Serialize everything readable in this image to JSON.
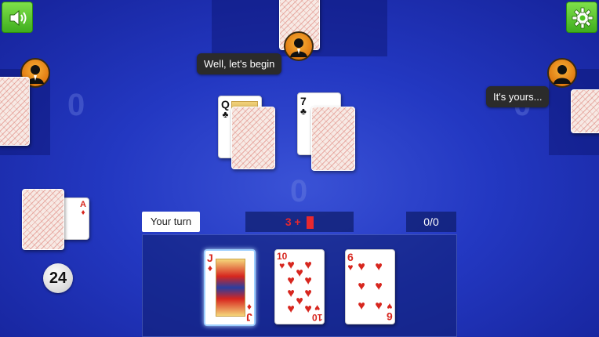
{
  "icons": {
    "sound": "speaker-icon",
    "settings": "gear-icon"
  },
  "colors": {
    "table": "#2338c2",
    "accent_red": "#d7261e",
    "button_green": "#4fc424"
  },
  "players": {
    "top": {
      "speech": "Well, let's begin",
      "score_ghost": "0"
    },
    "left": {
      "score_ghost": "0"
    },
    "right": {
      "speech": "It's yours...",
      "score_ghost": "0"
    },
    "self": {
      "score_ghost": "0"
    }
  },
  "table_cards": {
    "left_pile": {
      "rank": "Q",
      "suit": "♣"
    },
    "right_pile": {
      "rank": "7",
      "suit": "♣"
    }
  },
  "deck": {
    "remaining": "24",
    "visible_card": {
      "rank": "A",
      "suit": "♦"
    }
  },
  "status": {
    "turn_label": "Your turn",
    "score_prefix": "3 +",
    "tricks": "0/0"
  },
  "hand": [
    {
      "rank": "J",
      "suit": "♦",
      "color": "red"
    },
    {
      "rank": "10",
      "suit": "♥",
      "color": "red"
    },
    {
      "rank": "6",
      "suit": "♥",
      "color": "red"
    }
  ]
}
